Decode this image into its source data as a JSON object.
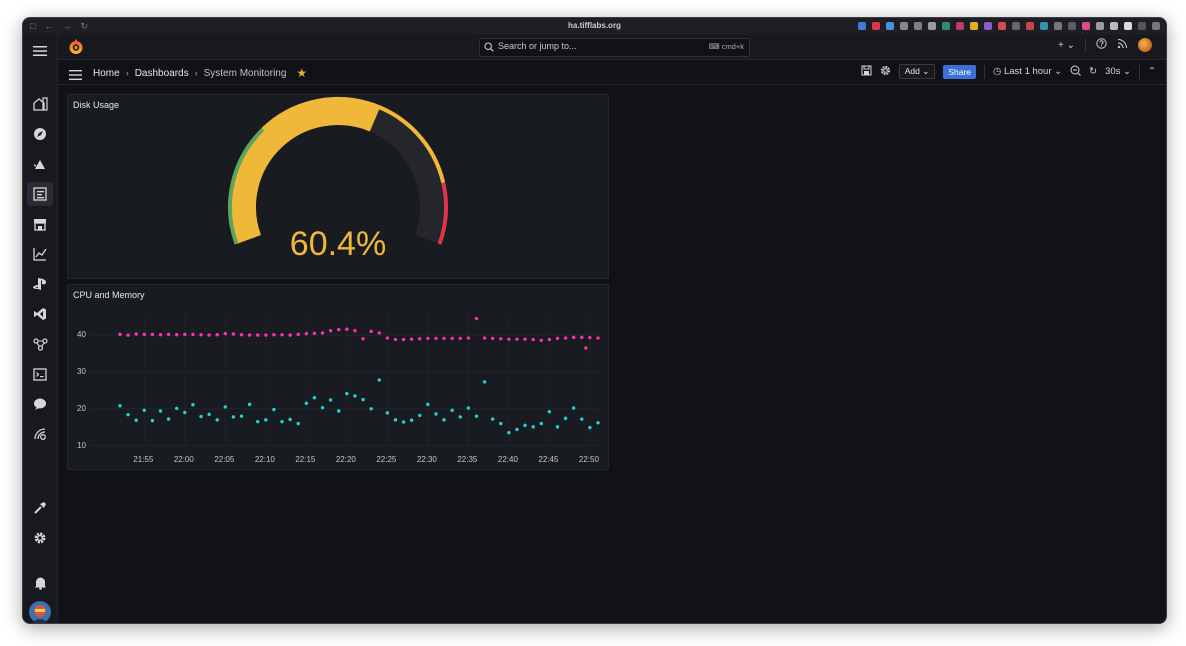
{
  "browser": {
    "url": "ha.tifflabs.org"
  },
  "topbar": {
    "search_placeholder": "Search or jump to...",
    "search_shortcut": "cmd+k"
  },
  "breadcrumb": {
    "items": [
      "Home",
      "Dashboards",
      "System Monitoring"
    ]
  },
  "toolbar": {
    "add_label": "Add",
    "share_label": "Share",
    "time_range": "Last 1 hour",
    "refresh_interval": "30s"
  },
  "sidebar": {
    "icons": [
      "home-icon",
      "explore-icon",
      "alerting-icon",
      "dashboards-icon",
      "store-icon",
      "metrics-icon",
      "playstation-icon",
      "vscode-icon",
      "connections-icon",
      "terminal-icon",
      "chat-icon",
      "radar-icon",
      "tools-icon",
      "gear-icon",
      "bell-icon",
      "avatar"
    ]
  },
  "panels": {
    "disk": {
      "title": "Disk Usage",
      "value": 60.4,
      "display": "60.4%",
      "thresholds": {
        "green_until": 30,
        "yellow_until": 85,
        "max": 100
      },
      "colors": {
        "value": "#f0b838",
        "green": "#5aa65a",
        "yellow": "#f0b838",
        "red": "#e0344a",
        "track": "#25262c"
      }
    },
    "cpu_memory": {
      "title": "CPU and Memory"
    }
  },
  "chart_data": {
    "type": "scatter",
    "title": "CPU and Memory",
    "x_ticks": [
      "21:55",
      "22:00",
      "22:05",
      "22:10",
      "22:15",
      "22:20",
      "22:25",
      "22:30",
      "22:35",
      "22:40",
      "22:45",
      "22:50"
    ],
    "y_ticks": [
      10,
      20,
      30,
      40
    ],
    "xlim": [
      "21:52",
      "22:51"
    ],
    "ylim": [
      8,
      46
    ],
    "grid": true,
    "series": [
      {
        "color": "#ff2fb3",
        "points": [
          [
            "21:52",
            40.2
          ],
          [
            "21:53",
            40.0
          ],
          [
            "21:54",
            40.3
          ],
          [
            "21:55",
            40.2
          ],
          [
            "21:56",
            40.2
          ],
          [
            "21:57",
            40.1
          ],
          [
            "21:58",
            40.2
          ],
          [
            "21:59",
            40.1
          ],
          [
            "22:00",
            40.2
          ],
          [
            "22:01",
            40.2
          ],
          [
            "22:02",
            40.1
          ],
          [
            "22:03",
            40.0
          ],
          [
            "22:04",
            40.1
          ],
          [
            "22:05",
            40.4
          ],
          [
            "22:06",
            40.3
          ],
          [
            "22:07",
            40.1
          ],
          [
            "22:08",
            40.0
          ],
          [
            "22:09",
            40.0
          ],
          [
            "22:10",
            40.0
          ],
          [
            "22:11",
            40.1
          ],
          [
            "22:12",
            40.1
          ],
          [
            "22:13",
            40.0
          ],
          [
            "22:14",
            40.2
          ],
          [
            "22:15",
            40.4
          ],
          [
            "22:16",
            40.5
          ],
          [
            "22:17",
            40.6
          ],
          [
            "22:18",
            41.2
          ],
          [
            "22:19",
            41.5
          ],
          [
            "22:20",
            41.6
          ],
          [
            "22:21",
            41.2
          ],
          [
            "22:22",
            39.0
          ],
          [
            "22:23",
            41.0
          ],
          [
            "22:24",
            40.6
          ],
          [
            "22:25",
            39.2
          ],
          [
            "22:26",
            38.8
          ],
          [
            "22:27",
            38.8
          ],
          [
            "22:28",
            38.9
          ],
          [
            "22:29",
            39.0
          ],
          [
            "22:30",
            39.1
          ],
          [
            "22:31",
            39.1
          ],
          [
            "22:32",
            39.1
          ],
          [
            "22:33",
            39.1
          ],
          [
            "22:34",
            39.1
          ],
          [
            "22:35",
            39.2
          ],
          [
            "22:36",
            44.5
          ],
          [
            "22:37",
            39.2
          ],
          [
            "22:38",
            39.1
          ],
          [
            "22:39",
            39.0
          ],
          [
            "22:40",
            38.9
          ],
          [
            "22:41",
            38.9
          ],
          [
            "22:42",
            38.9
          ],
          [
            "22:43",
            38.8
          ],
          [
            "22:44",
            38.6
          ],
          [
            "22:45",
            38.8
          ],
          [
            "22:46",
            39.1
          ],
          [
            "22:47",
            39.2
          ],
          [
            "22:48",
            39.4
          ],
          [
            "22:49",
            39.4
          ],
          [
            "22:50",
            39.3
          ],
          [
            "22:51",
            39.2
          ],
          [
            "22:49.5",
            36.5
          ]
        ]
      },
      {
        "color": "#1fd4d8",
        "points": [
          [
            "21:52",
            20.8
          ],
          [
            "21:53",
            18.4
          ],
          [
            "21:54",
            16.9
          ],
          [
            "21:55",
            19.6
          ],
          [
            "21:56",
            16.8
          ],
          [
            "21:57",
            19.4
          ],
          [
            "21:58",
            17.2
          ],
          [
            "21:59",
            20.1
          ],
          [
            "22:00",
            19.0
          ],
          [
            "22:01",
            21.1
          ],
          [
            "22:02",
            17.9
          ],
          [
            "22:03",
            18.5
          ],
          [
            "22:04",
            17.0
          ],
          [
            "22:05",
            20.5
          ],
          [
            "22:06",
            17.8
          ],
          [
            "22:07",
            18.0
          ],
          [
            "22:08",
            21.2
          ],
          [
            "22:09",
            16.5
          ],
          [
            "22:10",
            17.0
          ],
          [
            "22:11",
            19.8
          ],
          [
            "22:12",
            16.5
          ],
          [
            "22:13",
            17.1
          ],
          [
            "22:14",
            16.0
          ],
          [
            "22:15",
            21.5
          ],
          [
            "22:16",
            23.0
          ],
          [
            "22:17",
            20.3
          ],
          [
            "22:18",
            22.4
          ],
          [
            "22:19",
            19.4
          ],
          [
            "22:20",
            24.1
          ],
          [
            "22:21",
            23.5
          ],
          [
            "22:22",
            22.5
          ],
          [
            "22:23",
            20.0
          ],
          [
            "22:24",
            27.8
          ],
          [
            "22:25",
            18.9
          ],
          [
            "22:26",
            17.0
          ],
          [
            "22:27",
            16.4
          ],
          [
            "22:28",
            16.9
          ],
          [
            "22:29",
            18.2
          ],
          [
            "22:30",
            21.2
          ],
          [
            "22:31",
            18.6
          ],
          [
            "22:32",
            17.0
          ],
          [
            "22:33",
            19.6
          ],
          [
            "22:34",
            17.8
          ],
          [
            "22:35",
            20.2
          ],
          [
            "22:36",
            18.0
          ],
          [
            "22:37",
            27.3
          ],
          [
            "22:38",
            17.2
          ],
          [
            "22:39",
            16.0
          ],
          [
            "22:40",
            13.5
          ],
          [
            "22:41",
            14.4
          ],
          [
            "22:42",
            15.5
          ],
          [
            "22:43",
            15.1
          ],
          [
            "22:44",
            16.0
          ],
          [
            "22:45",
            19.2
          ],
          [
            "22:46",
            15.1
          ],
          [
            "22:47",
            17.4
          ],
          [
            "22:48",
            20.2
          ],
          [
            "22:49",
            17.2
          ],
          [
            "22:50",
            14.9
          ],
          [
            "22:51",
            16.2
          ]
        ]
      }
    ]
  }
}
